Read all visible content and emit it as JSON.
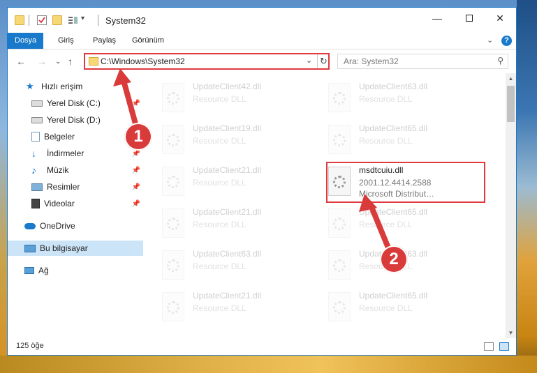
{
  "window": {
    "title": "System32"
  },
  "ribbon": {
    "tabs": [
      {
        "label": "Dosya"
      },
      {
        "label": "Giriş"
      },
      {
        "label": "Paylaş"
      },
      {
        "label": "Görünüm"
      }
    ]
  },
  "nav": {
    "address": "C:\\Windows\\System32",
    "search_placeholder": "Ara: System32"
  },
  "sidebar": {
    "quick_access": "Hızlı erişim",
    "items": [
      {
        "label": "Yerel Disk (C:)",
        "icon": "drive-icon"
      },
      {
        "label": "Yerel Disk (D:)",
        "icon": "drive-icon"
      },
      {
        "label": "Belgeler",
        "icon": "documents-icon"
      },
      {
        "label": "İndirmeler",
        "icon": "downloads-icon"
      },
      {
        "label": "Müzik",
        "icon": "music-icon"
      },
      {
        "label": "Resimler",
        "icon": "pictures-icon"
      },
      {
        "label": "Videolar",
        "icon": "videos-icon"
      }
    ],
    "onedrive": "OneDrive",
    "this_pc": "Bu bilgisayar",
    "network": "Ağ"
  },
  "files": {
    "left_column": [
      {
        "name": "UpdateClient42.dll",
        "desc": "Resource DLL"
      },
      {
        "name": "UpdateClient19.dll",
        "desc": "Resource DLL"
      },
      {
        "name": "UpdateClient21.dll",
        "desc": "Resource DLL"
      },
      {
        "name": "UpdateClient21.dll",
        "desc": "Resource DLL"
      },
      {
        "name": "UpdateClient63.dll",
        "desc": "Resource DLL"
      },
      {
        "name": "UpdateClient21.dll",
        "desc": "Resource DLL"
      }
    ],
    "right_column": [
      {
        "name": "UpdateClient63.dll",
        "desc": "Resource DLL"
      },
      {
        "name": "UpdateClient65.dll",
        "desc": "Resource DLL"
      },
      {
        "name": "UpdateClient65.dll",
        "desc": "Resource DLL"
      },
      {
        "name": "UpdateClient63.dll",
        "desc": "Resource DLL"
      },
      {
        "name": "UpdateClient65.dll",
        "desc": "Resource DLL"
      }
    ],
    "highlighted": {
      "name": "msdtcuiu.dll",
      "version": "2001.12.4414.2588",
      "company": "Microsoft Distribut…"
    }
  },
  "status": {
    "count": "125 öğe"
  },
  "annotations": {
    "step1": "1",
    "step2": "2",
    "color": "#d93a3a"
  }
}
